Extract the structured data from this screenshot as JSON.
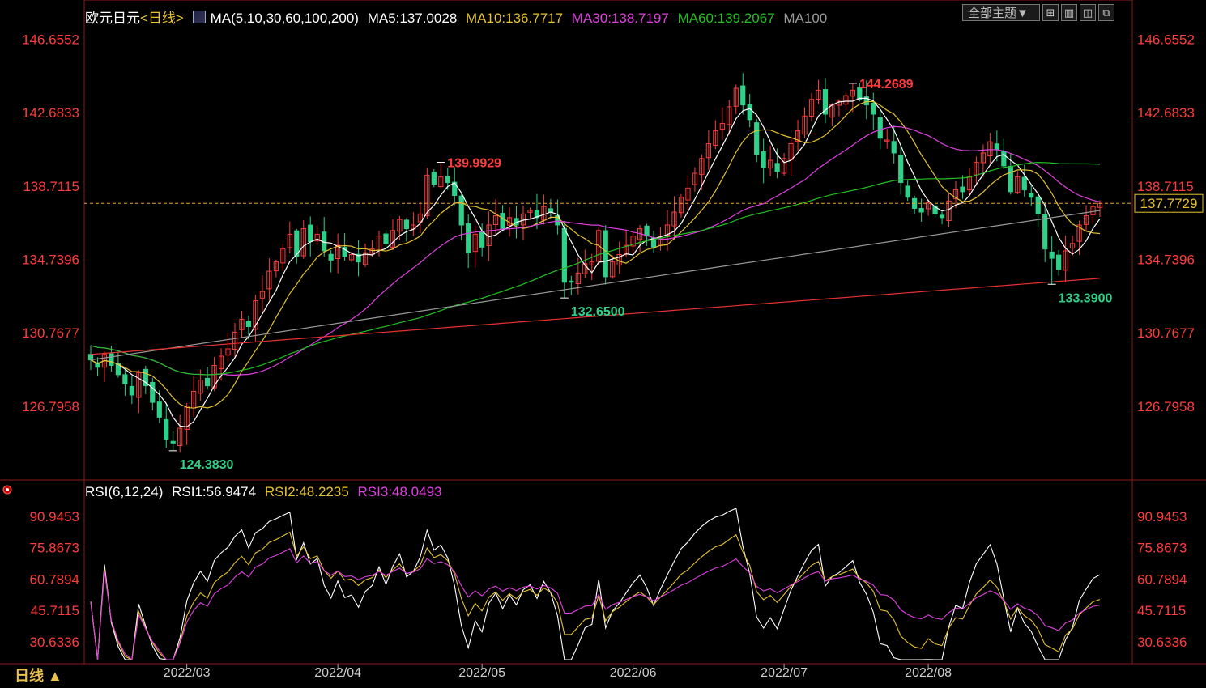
{
  "header": {
    "title": "欧元日元",
    "period_tag": "<日线>",
    "ma_label": "MA(5,10,30,60,100,200)",
    "ma5": "MA5:137.0028",
    "ma10": "MA10:136.7717",
    "ma30": "MA30:138.7197",
    "ma60": "MA60:139.2067",
    "ma100": "MA100"
  },
  "toolbar": {
    "theme_button": "全部主题▼",
    "buttons": [
      "⊞",
      "▥",
      "◫",
      "⧉"
    ]
  },
  "rsi_header": {
    "label": "RSI(6,12,24)",
    "rsi1": "RSI1:56.9474",
    "rsi2": "RSI2:48.2235",
    "rsi3": "RSI3:48.0493"
  },
  "period_button": "日线 ▲",
  "colors": {
    "up": "#ff3b3b",
    "down": "#2fd08a",
    "ma5": "#ffffff",
    "ma10": "#e6c230",
    "ma30": "#e040e0",
    "ma60": "#22c022",
    "ma100": "#999999",
    "ma200": "#e83030",
    "axis_text": "#ff3b3b",
    "grid": "#8a1a1a"
  },
  "chart_data": [
    {
      "type": "candlestick",
      "y_ticks": [
        "146.6552",
        "142.6833",
        "138.7115",
        "134.7396",
        "130.7677",
        "126.7958"
      ],
      "ylim": [
        122.8,
        147.2
      ],
      "x_ticks": [
        "2022/03",
        "2022/04",
        "2022/05",
        "2022/06",
        "2022/07",
        "2022/08"
      ],
      "current_price": "137.7729",
      "annotations": [
        {
          "label": "124.3830",
          "value": 124.383,
          "kind": "low"
        },
        {
          "label": "139.9929",
          "value": 139.9929,
          "kind": "high"
        },
        {
          "label": "132.6500",
          "value": 132.65,
          "kind": "low"
        },
        {
          "label": "144.2689",
          "value": 144.2689,
          "kind": "high"
        },
        {
          "label": "133.3900",
          "value": 133.39,
          "kind": "low"
        }
      ],
      "closes": [
        129.3,
        128.9,
        129.6,
        129.0,
        128.5,
        128.0,
        127.4,
        128.6,
        127.9,
        127.0,
        126.2,
        125.0,
        124.8,
        125.6,
        126.8,
        127.6,
        128.2,
        127.9,
        129.0,
        129.5,
        129.9,
        130.8,
        131.5,
        131.1,
        132.5,
        133.0,
        134.1,
        134.6,
        135.3,
        136.1,
        134.9,
        136.4,
        135.7,
        136.1,
        135.2,
        134.7,
        135.5,
        134.9,
        135.0,
        134.6,
        135.1,
        135.3,
        136.0,
        135.6,
        136.3,
        136.9,
        136.4,
        136.6,
        137.2,
        139.3,
        138.8,
        139.2,
        138.9,
        138.2,
        136.6,
        135.1,
        136.1,
        135.4,
        136.6,
        137.1,
        136.4,
        137.0,
        136.6,
        137.2,
        137.4,
        137.0,
        137.6,
        137.3,
        136.6,
        133.5,
        133.5,
        134.0,
        134.5,
        134.6,
        136.3,
        133.8,
        134.6,
        135.0,
        135.5,
        136.0,
        136.4,
        136.0,
        135.4,
        136.0,
        136.6,
        137.3,
        138.1,
        138.6,
        139.4,
        140.2,
        141.0,
        141.7,
        142.1,
        143.0,
        144.0,
        143.1,
        142.3,
        140.4,
        139.7,
        140.1,
        139.5,
        140.2,
        141.0,
        141.7,
        142.5,
        143.4,
        143.9,
        142.6,
        143.1,
        143.3,
        143.6,
        143.9,
        143.4,
        143.1,
        142.6,
        141.3,
        141.2,
        140.5,
        138.9,
        138.1,
        137.5,
        137.3,
        137.8,
        137.2,
        137.0,
        137.9,
        138.5,
        138.4,
        139.2,
        140.0,
        140.5,
        141.1,
        140.7,
        139.8,
        138.4,
        139.2,
        138.5,
        138.1,
        137.2,
        135.3,
        134.8,
        134.2,
        135.2,
        135.6,
        136.6,
        137.1,
        137.6,
        137.77
      ],
      "series_names": [
        "MA5",
        "MA10",
        "MA30",
        "MA60",
        "MA100",
        "MA200"
      ]
    },
    {
      "type": "line",
      "y_ticks": [
        "90.9453",
        "75.8673",
        "60.7894",
        "45.7115",
        "30.6336"
      ],
      "ylim": [
        22,
        96
      ],
      "series_names": [
        "RSI1",
        "RSI2",
        "RSI3"
      ]
    }
  ]
}
